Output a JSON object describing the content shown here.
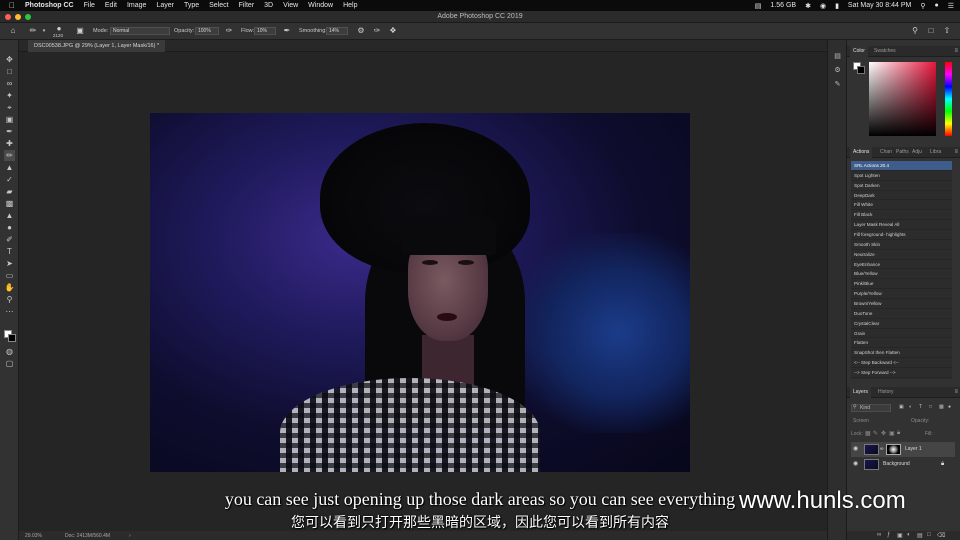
{
  "menubar": {
    "app": "Photoshop CC",
    "items": [
      "File",
      "Edit",
      "Image",
      "Layer",
      "Type",
      "Select",
      "Filter",
      "3D",
      "View",
      "Window",
      "Help"
    ],
    "memory": "1.56 GB",
    "clock": "Sat May 30  8:44 PM"
  },
  "window": {
    "title": "Adobe Photoshop CC 2019"
  },
  "options": {
    "brush_size": "2120",
    "mode_label": "Mode:",
    "mode_value": "Normal",
    "opacity_label": "Opacity:",
    "opacity_value": "100%",
    "flow_label": "Flow:",
    "flow_value": "10%",
    "smoothing_label": "Smoothing:",
    "smoothing_value": "14%"
  },
  "document": {
    "tab_label": "DSC00538.JPG @ 29% (Layer 1, Layer Mask/16) *"
  },
  "status": {
    "zoom": "29.03%",
    "doc": "Doc: 2413M/560.4M"
  },
  "color_panel": {
    "tabs": [
      "Color",
      "Swatches"
    ],
    "foreground": "#ffffff",
    "background": "#000000"
  },
  "actions_panel": {
    "tabs": [
      "Actions",
      "Chan",
      "Paths",
      "Adju",
      "Libra"
    ],
    "items": [
      "SRL Actions 20.4",
      "Spot Lighten",
      "Spot Darken",
      "DeepDark",
      "Fill White",
      "Fill Black",
      "Layer Mask Reveal All",
      "Fill foreground- highlights",
      "Smooth Skin",
      "Neutralize",
      "EyeEnhance",
      "Blue/Yellow",
      "Pink/Blue",
      "Purple/Yellow",
      "Brown/Yellow",
      "DuoTone",
      "CrystalClear",
      "Grain",
      "Flatten",
      "SnapShot then Flatten",
      "<-- Step Backward <--",
      "--> Step Forward -->"
    ]
  },
  "layers_panel": {
    "tabs": [
      "Layers",
      "History"
    ],
    "filter": "Kind",
    "blend_mode": "Screen",
    "opacity_label": "Opacity:",
    "lock_label": "Lock:",
    "fill_label": "Fill:",
    "layers": [
      "Layer 1",
      "Background"
    ]
  },
  "subtitles": {
    "english": "you can see just opening up those dark areas so you can see everything",
    "chinese": "您可以看到只打开那些黑暗的区域，因此您可以看到所有内容"
  },
  "watermark": "www.hunls.com"
}
